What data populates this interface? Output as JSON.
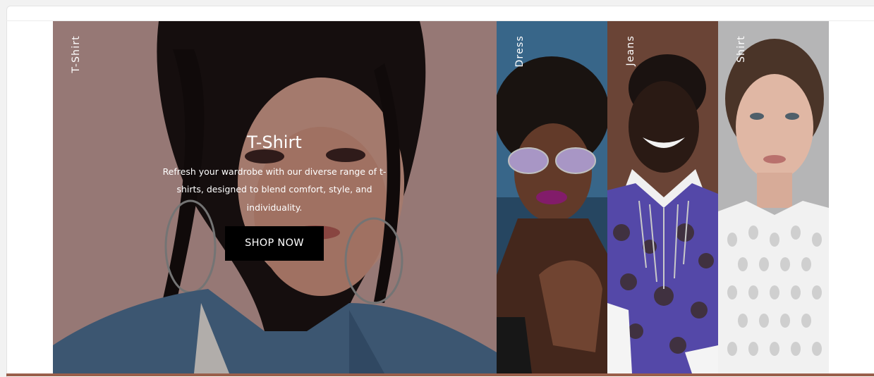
{
  "slider": {
    "panels": [
      {
        "label": "T-Shirt"
      },
      {
        "label": "Dress"
      },
      {
        "label": "Jeans"
      },
      {
        "label": "Shirt"
      }
    ],
    "active": {
      "title": "T-Shirt",
      "description": "Refresh your wardrobe with our diverse range of t-shirts, designed to blend comfort, style, and individuality.",
      "cta_label": "SHOP NOW"
    }
  },
  "colors": {
    "button_bg": "#000000",
    "bottom_accent": "#9a5f4b"
  }
}
